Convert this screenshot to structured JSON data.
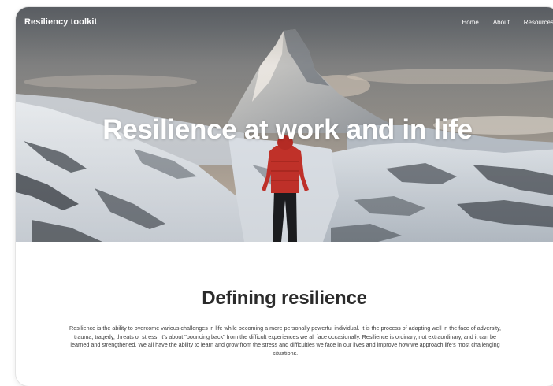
{
  "nav": {
    "brand": "Resiliency toolkit",
    "links": [
      {
        "label": "Home"
      },
      {
        "label": "About"
      },
      {
        "label": "Resources"
      }
    ]
  },
  "hero": {
    "title": "Resilience at work and in life"
  },
  "section": {
    "title": "Defining resilience",
    "body": "Resilience is the ability to overcome various challenges in life while becoming a more personally powerful individual. It is the process of adapting well in the face of adversity, trauma, tragedy, threats or stress. It's about \"bouncing back\" from the difficult experiences we all face occasionally. Resilience is ordinary, not extraordinary, and it can be learned and strengthened. We all have the ability to learn and grow from the stress and difficulties we face in our lives and improve how we approach life's most challenging situations."
  },
  "colors": {
    "sky_top": "#6f747a",
    "sky_bottom": "#a9a199",
    "snow": "#e7ebef",
    "rock": "#3a3f45",
    "jacket": "#c5322a",
    "text_dark": "#2b2b2b"
  },
  "icons": {
    "hero_image": "mountain-hiker-image"
  }
}
